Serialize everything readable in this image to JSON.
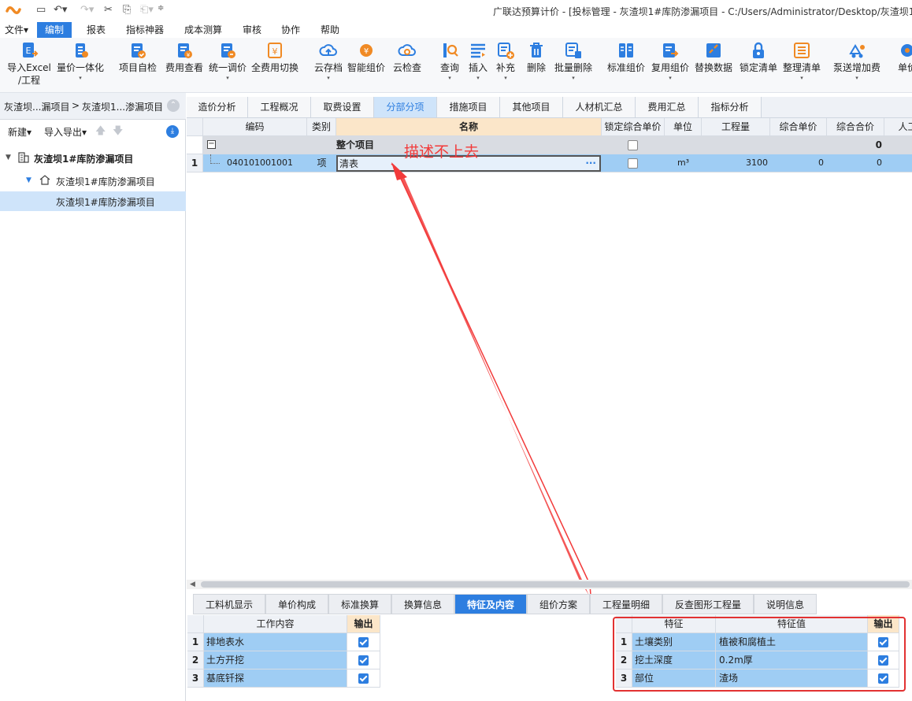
{
  "titlebar": {
    "title": "广联达预算计价 - [投标管理 - 灰渣坝1#库防渗漏项目 - C:/Users/Administrator/Desktop/灰渣坝1"
  },
  "menu": [
    "文件▾",
    "编制",
    "报表",
    "指标神器",
    "成本测算",
    "审核",
    "协作",
    "帮助"
  ],
  "ribbon": [
    {
      "label": "导入Excel",
      "label2": "/工程",
      "icon": "excel-import-icon"
    },
    {
      "label": "量价一体化",
      "icon": "quantity-price-icon"
    },
    {
      "label": "项目自检",
      "icon": "self-check-icon"
    },
    {
      "label": "费用查看",
      "icon": "fee-view-icon"
    },
    {
      "label": "统一调价",
      "icon": "price-adjust-icon"
    },
    {
      "label": "全费用切换",
      "icon": "full-fee-switch-icon"
    },
    {
      "label": "云存档",
      "icon": "cloud-archive-icon"
    },
    {
      "label": "智能组价",
      "icon": "smart-price-icon"
    },
    {
      "label": "云检查",
      "icon": "cloud-check-icon"
    },
    {
      "label": "查询",
      "icon": "query-icon"
    },
    {
      "label": "插入",
      "icon": "insert-icon"
    },
    {
      "label": "补充",
      "icon": "supplement-icon"
    },
    {
      "label": "删除",
      "icon": "delete-icon"
    },
    {
      "label": "批量删除",
      "icon": "batch-delete-icon"
    },
    {
      "label": "标准组价",
      "icon": "standard-price-icon"
    },
    {
      "label": "复用组价",
      "icon": "reuse-price-icon"
    },
    {
      "label": "替换数据",
      "icon": "replace-data-icon"
    },
    {
      "label": "锁定清单",
      "icon": "lock-list-icon"
    },
    {
      "label": "整理清单",
      "icon": "organize-list-icon"
    },
    {
      "label": "泵送增加费",
      "icon": "pump-fee-icon"
    },
    {
      "label": "单价",
      "icon": "unit-price-icon"
    }
  ],
  "left": {
    "crumb1": "灰渣坝...漏项目",
    "crumb_sep": ">",
    "crumb2": "灰渣坝1...渗漏项目",
    "new_label": "新建▾",
    "import_label": "导入导出▾",
    "tree": [
      {
        "label": "灰渣坝1#库防渗漏项目"
      },
      {
        "label": "灰渣坝1#库防渗漏项目"
      },
      {
        "label": "灰渣坝1#库防渗漏项目"
      }
    ]
  },
  "tabs": [
    "造价分析",
    "工程概况",
    "取费设置",
    "分部分项",
    "措施项目",
    "其他项目",
    "人材机汇总",
    "费用汇总",
    "指标分析"
  ],
  "grid": {
    "headers": [
      "编码",
      "类别",
      "名称",
      "锁定综合单价",
      "单位",
      "工程量",
      "综合单价",
      "综合合价",
      "人工"
    ],
    "top_row": {
      "collapse": "−",
      "name": "整个项目",
      "total": "0"
    },
    "rows": [
      {
        "num": "1",
        "code": "040101001001",
        "type": "项",
        "name": "清表",
        "more": "···",
        "unit": "m³",
        "qty": "3100",
        "price": "0",
        "total": "0"
      }
    ]
  },
  "annotation": "描述不上去",
  "bottom_tabs": [
    "工料机显示",
    "单价构成",
    "标准换算",
    "换算信息",
    "特征及内容",
    "组价方案",
    "工程量明细",
    "反查图形工程量",
    "说明信息"
  ],
  "work": {
    "headers": [
      "工作内容",
      "输出"
    ],
    "rows": [
      {
        "num": "1",
        "content": "排地表水"
      },
      {
        "num": "2",
        "content": "土方开挖"
      },
      {
        "num": "3",
        "content": "基底钎探"
      }
    ]
  },
  "features": {
    "headers": [
      "特征",
      "特征值",
      "输出"
    ],
    "rows": [
      {
        "num": "1",
        "name": "土壤类别",
        "value": "植被和腐植土"
      },
      {
        "num": "2",
        "name": "挖土深度",
        "value": "0.2m厚"
      },
      {
        "num": "3",
        "name": "部位",
        "value": "渣场"
      }
    ]
  },
  "colors": {
    "accent": "#2d7ee0",
    "annotation": "#f23a3a",
    "selected_row": "#9fcdf4"
  }
}
